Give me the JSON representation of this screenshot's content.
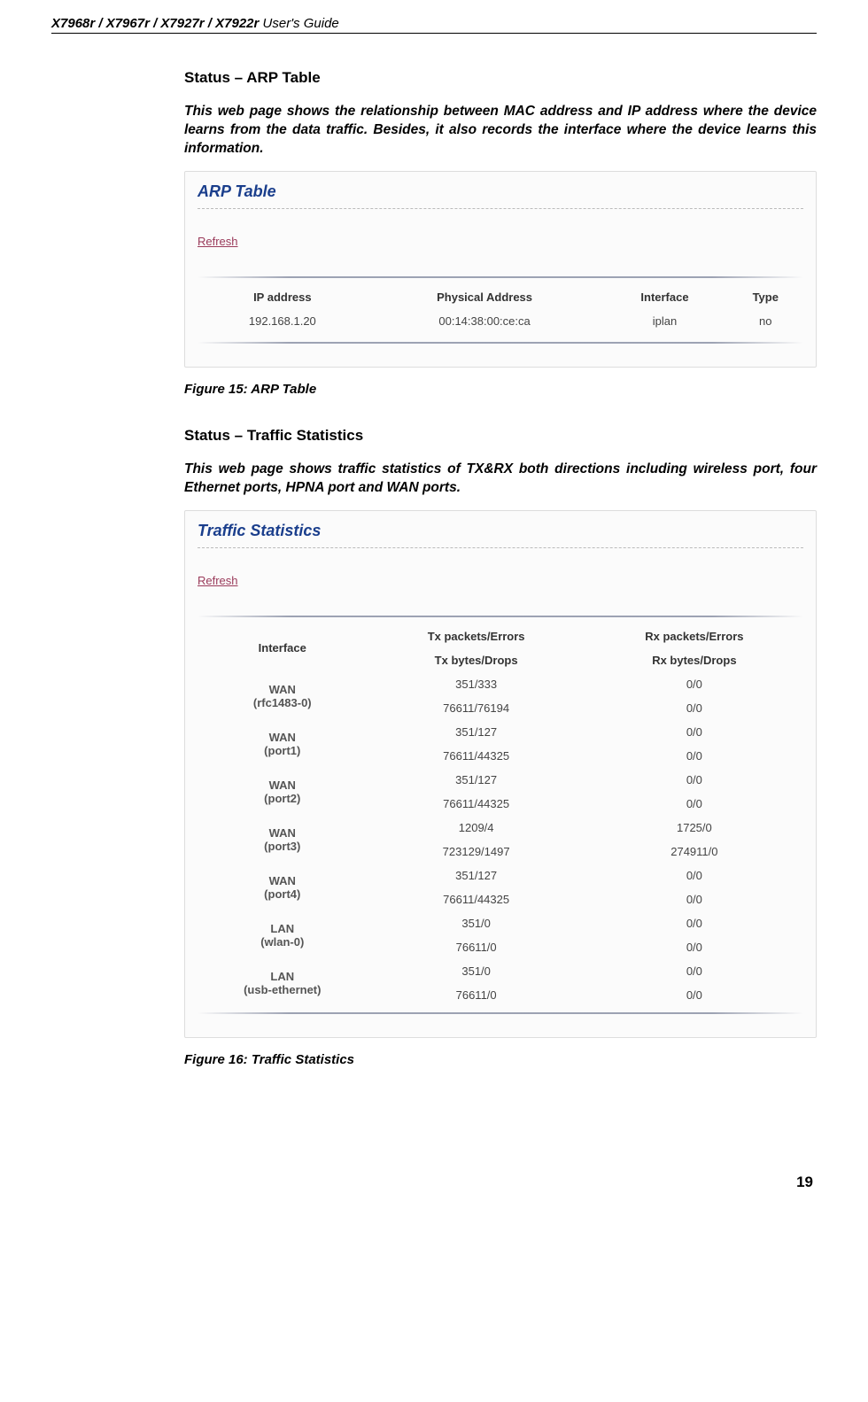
{
  "header": {
    "models": "X7968r / X7967r / X7927r / X7922r",
    "suffix": " User's Guide"
  },
  "section1": {
    "title": "Status – ARP Table",
    "intro": "This web page shows the relationship between MAC address and IP address where the device learns from the data traffic. Besides, it also records the interface where the device learns this information.",
    "panel_title": "ARP Table",
    "refresh": "Refresh",
    "cols": {
      "ip": "IP address",
      "phys": "Physical Address",
      "iface": "Interface",
      "type": "Type"
    },
    "row": {
      "ip": "192.168.1.20",
      "phys": "00:14:38:00:ce:ca",
      "iface": "iplan",
      "type": "no"
    },
    "caption": "Figure 15: ARP Table"
  },
  "section2": {
    "title": "Status – Traffic Statistics",
    "intro": "This web page shows traffic statistics of TX&RX both directions including wireless port, four Ethernet ports, HPNA port and WAN ports.",
    "panel_title": "Traffic Statistics",
    "refresh": "Refresh",
    "cols": {
      "iface": "Interface",
      "tx1": "Tx packets/Errors",
      "tx2": "Tx bytes/Drops",
      "rx1": "Rx packets/Errors",
      "rx2": "Rx bytes/Drops"
    },
    "rows": [
      {
        "name1": "WAN",
        "name2": "(rfc1483-0)",
        "tx_a": "351/333",
        "tx_b": "76611/76194",
        "rx_a": "0/0",
        "rx_b": "0/0"
      },
      {
        "name1": "WAN",
        "name2": "(port1)",
        "tx_a": "351/127",
        "tx_b": "76611/44325",
        "rx_a": "0/0",
        "rx_b": "0/0"
      },
      {
        "name1": "WAN",
        "name2": "(port2)",
        "tx_a": "351/127",
        "tx_b": "76611/44325",
        "rx_a": "0/0",
        "rx_b": "0/0"
      },
      {
        "name1": "WAN",
        "name2": "(port3)",
        "tx_a": "1209/4",
        "tx_b": "723129/1497",
        "rx_a": "1725/0",
        "rx_b": "274911/0"
      },
      {
        "name1": "WAN",
        "name2": "(port4)",
        "tx_a": "351/127",
        "tx_b": "76611/44325",
        "rx_a": "0/0",
        "rx_b": "0/0"
      },
      {
        "name1": "LAN",
        "name2": "(wlan-0)",
        "tx_a": "351/0",
        "tx_b": "76611/0",
        "rx_a": "0/0",
        "rx_b": "0/0"
      },
      {
        "name1": "LAN",
        "name2": "(usb-ethernet)",
        "tx_a": "351/0",
        "tx_b": "76611/0",
        "rx_a": "0/0",
        "rx_b": "0/0"
      }
    ],
    "caption": "Figure 16: Traffic Statistics"
  },
  "page_number": "19"
}
